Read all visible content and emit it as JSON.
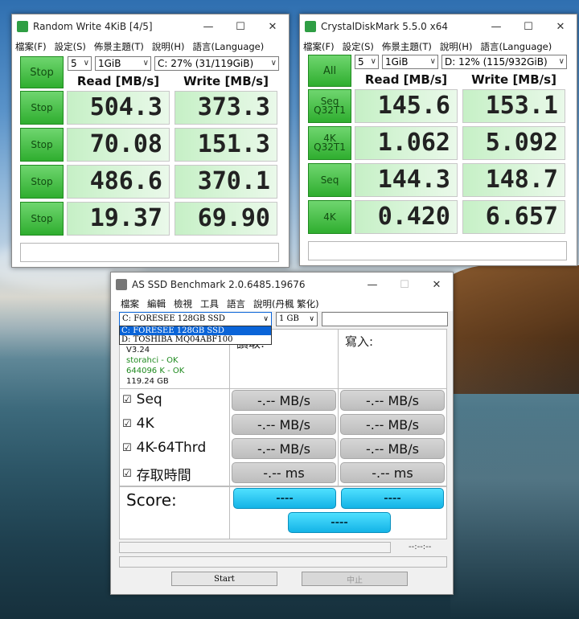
{
  "cdm_left": {
    "title": "Random Write 4KiB [4/5]",
    "menu": [
      "檔案(F)",
      "設定(S)",
      "佈景主題(T)",
      "說明(H)",
      "語言(Language)"
    ],
    "top_button": "Stop",
    "count": "5",
    "size": "1GiB",
    "drive": "C: 27% (31/119GiB)",
    "read_header": "Read [MB/s]",
    "write_header": "Write [MB/s]",
    "rows": [
      {
        "button": "Stop",
        "read": "504.3",
        "write": "373.3"
      },
      {
        "button": "Stop",
        "read": "70.08",
        "write": "151.3"
      },
      {
        "button": "Stop",
        "read": "486.6",
        "write": "370.1"
      },
      {
        "button": "Stop",
        "read": "19.37",
        "write": "69.90"
      }
    ]
  },
  "cdm_right": {
    "title": "CrystalDiskMark 5.5.0 x64",
    "menu": [
      "檔案(F)",
      "設定(S)",
      "佈景主題(T)",
      "說明(H)",
      "語言(Language)"
    ],
    "top_button": "All",
    "count": "5",
    "size": "1GiB",
    "drive": "D: 12% (115/932GiB)",
    "read_header": "Read [MB/s]",
    "write_header": "Write [MB/s]",
    "rows": [
      {
        "button": "Seq\nQ32T1",
        "read": "145.6",
        "write": "153.1"
      },
      {
        "button": "4K\nQ32T1",
        "read": "1.062",
        "write": "5.092"
      },
      {
        "button": "Seq",
        "read": "144.3",
        "write": "148.7"
      },
      {
        "button": "4K",
        "read": "0.420",
        "write": "6.657"
      }
    ]
  },
  "asssd": {
    "title": "AS SSD Benchmark 2.0.6485.19676",
    "menu": [
      "檔案",
      "編輯",
      "檢視",
      "工具",
      "語言",
      "說明(丹楓 繁化)"
    ],
    "drive_selected": "C: FORESEE 128GB SSD",
    "drive_options": [
      "C: FORESEE 128GB SSD",
      "D: TOSHIBA MQ04ABF100"
    ],
    "size": "1 GB",
    "read_header": "讀取:",
    "write_header": "寫入:",
    "info": {
      "version": "V3.24",
      "driver": "storahci - OK",
      "align": "644096 K - OK",
      "capacity": "119.24 GB"
    },
    "tests": [
      {
        "label": "Seq",
        "read": "-.-- MB/s",
        "write": "-.-- MB/s"
      },
      {
        "label": "4K",
        "read": "-.-- MB/s",
        "write": "-.-- MB/s"
      },
      {
        "label": "4K-64Thrd",
        "read": "-.-- MB/s",
        "write": "-.-- MB/s"
      },
      {
        "label": "存取時間",
        "read": "-.-- ms",
        "write": "-.-- ms"
      }
    ],
    "score_label": "Score:",
    "score_read": "----",
    "score_write": "----",
    "score_total": "----",
    "time": "--:--:--",
    "start_button": "Start",
    "abort_button": "中止"
  }
}
